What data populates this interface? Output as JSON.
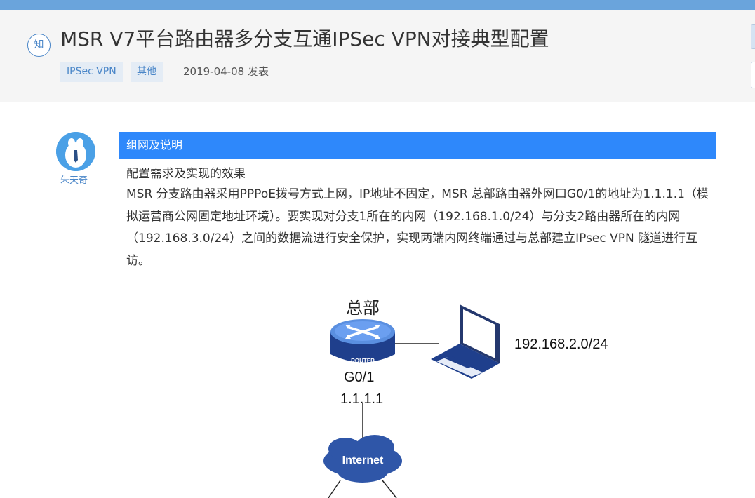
{
  "header": {
    "badge": "知",
    "title": "MSR V7平台路由器多分支互通IPSec VPN对接典型配置",
    "tags": [
      "IPSec VPN",
      "其他"
    ],
    "date": "2019-04-08 发表"
  },
  "author": {
    "name": "朱天奇"
  },
  "section": {
    "title": "组网及说明"
  },
  "content": {
    "heading": "配置需求及实现的效果",
    "body": "MSR 分支路由器采用PPPoE拨号方式上网，IP地址不固定，MSR 总部路由器外网口G0/1的地址为1.1.1.1（模拟运营商公网固定地址环境）。要实现对分支1所在的内网（192.168.1.0/24）与分支2路由器所在的内网（192.168.3.0/24）之间的数据流进行安全保护，实现两端内网终端通过与总部建立IPsec VPN 隧道进行互访。"
  },
  "diagram": {
    "hq_label": "总部",
    "router_text": "ROUTER",
    "subnet": "192.168.2.0/24",
    "iface": "G0/1",
    "iface_ip": "1.1.1.1",
    "cloud_label": "Internet"
  }
}
